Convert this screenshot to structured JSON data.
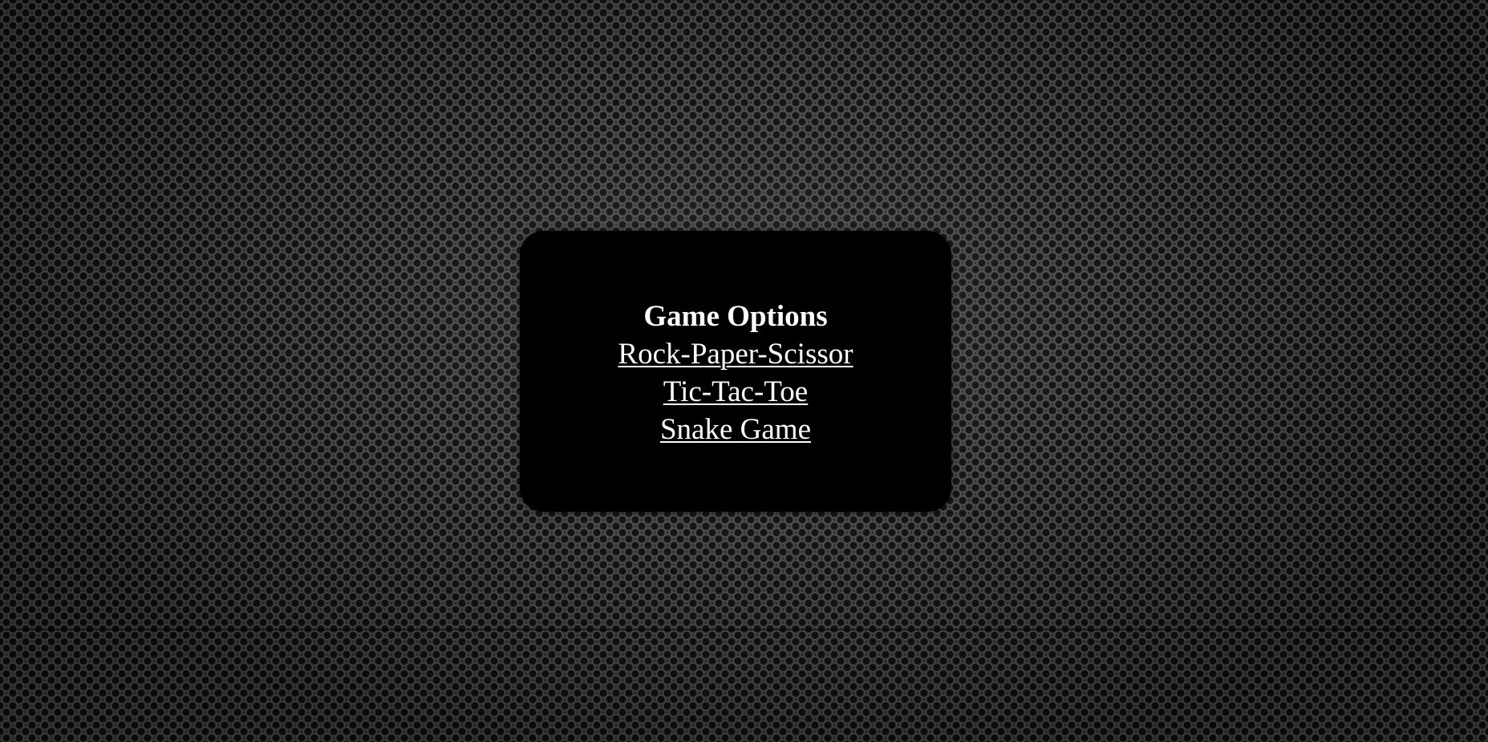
{
  "menu": {
    "title": "Game Options",
    "links": [
      {
        "label": "Rock-Paper-Scissor"
      },
      {
        "label": "Tic-Tac-Toe"
      },
      {
        "label": "Snake Game"
      }
    ]
  },
  "colors": {
    "panel_background": "#000000",
    "text": "#ffffff",
    "page_background": "#2b2b2b"
  }
}
